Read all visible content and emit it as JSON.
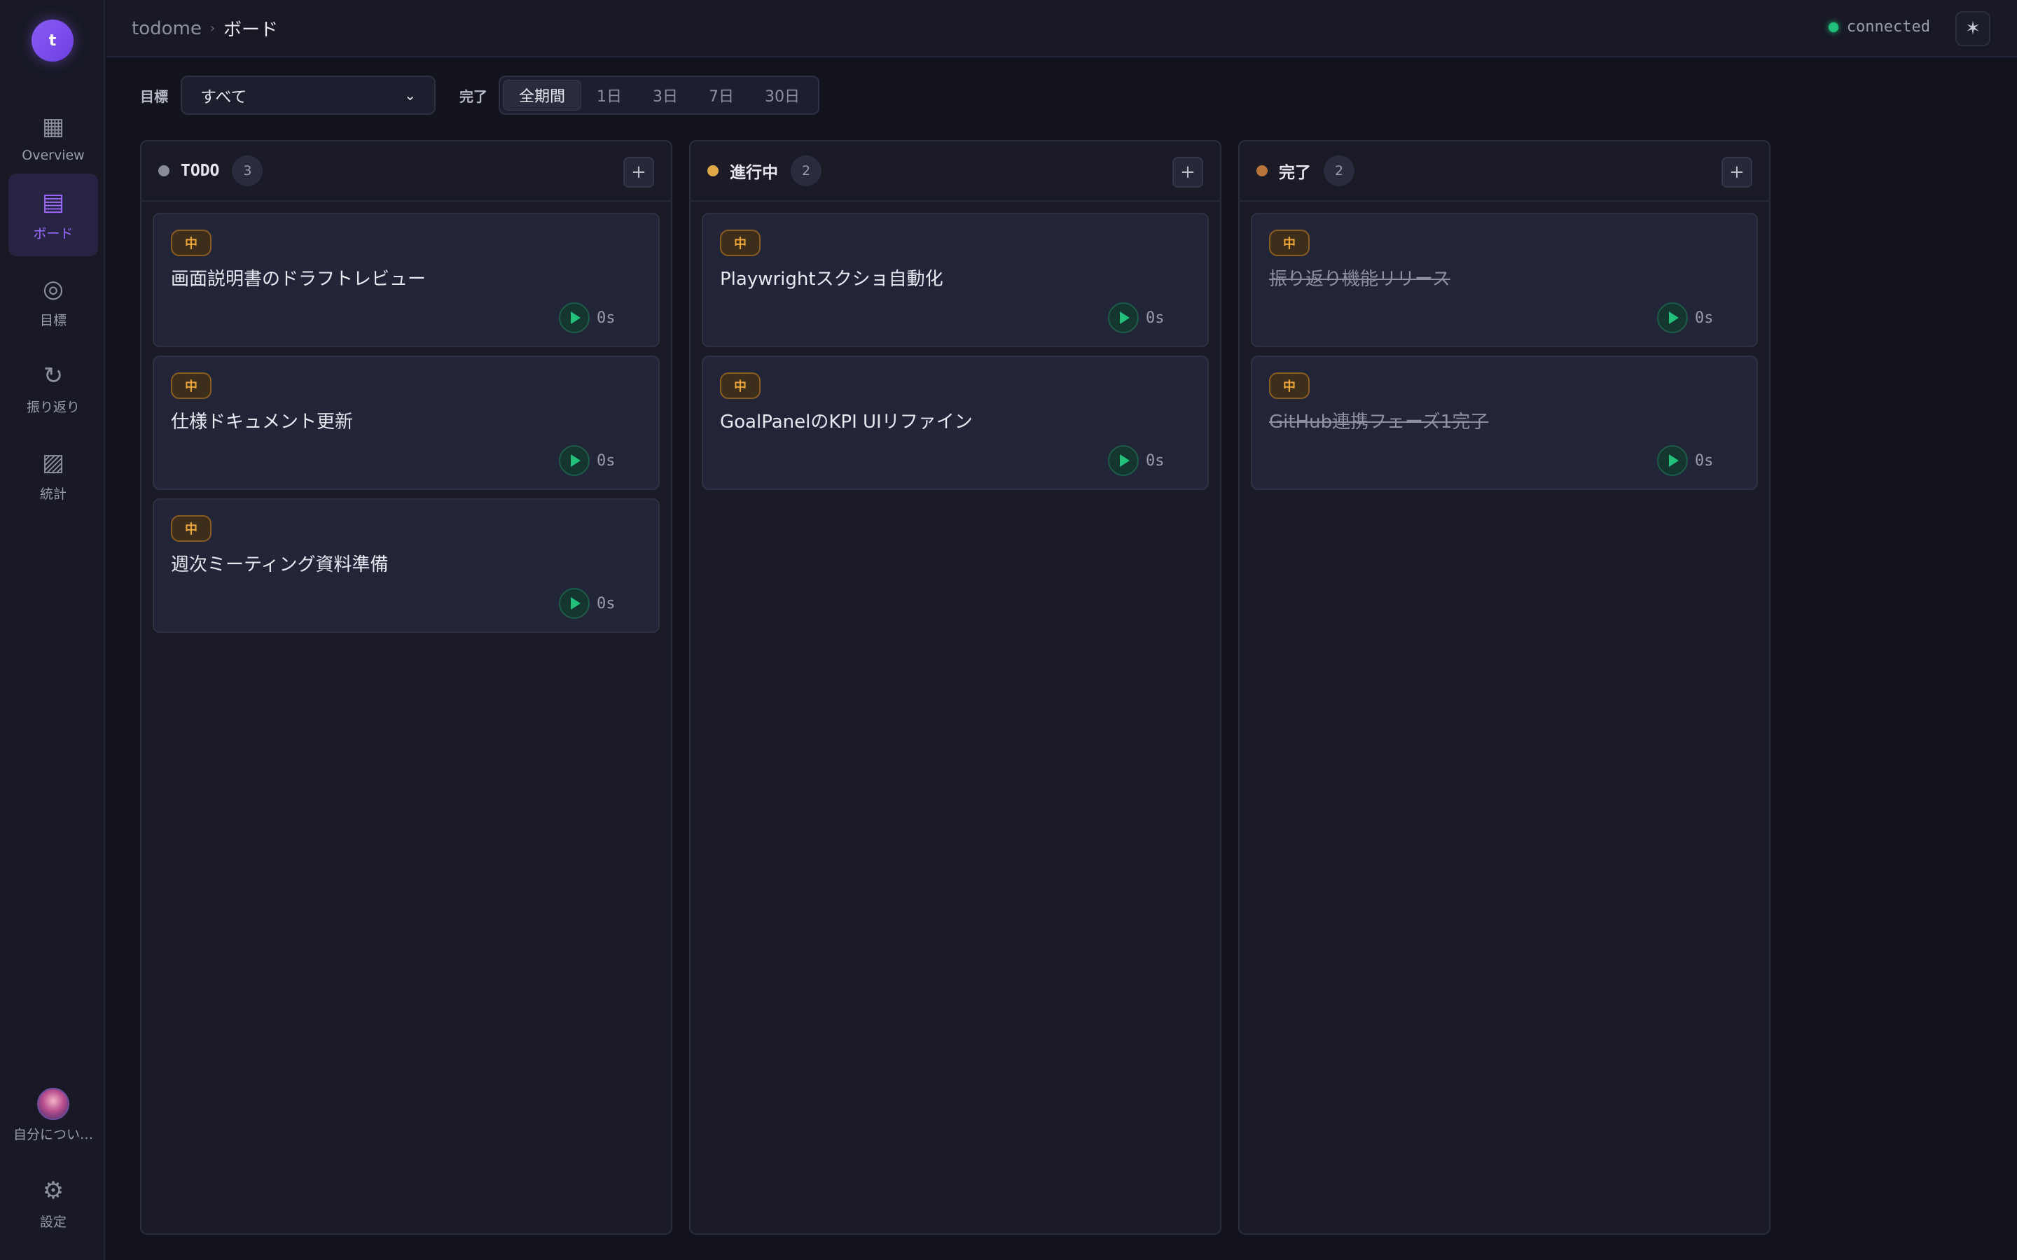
{
  "app": {
    "logo_letter": "t",
    "name": "todome"
  },
  "sidebar": {
    "items": [
      {
        "label": "Overview",
        "icon": "▦"
      },
      {
        "label": "ボード",
        "icon": "▤"
      },
      {
        "label": "目標",
        "icon": "◎"
      },
      {
        "label": "振り返り",
        "icon": "↻"
      },
      {
        "label": "統計",
        "icon": "▨"
      }
    ],
    "profile_label": "自分につい…",
    "settings_label": "設定",
    "settings_icon": "⚙"
  },
  "header": {
    "crumb_root": "todome",
    "crumb_sep": "›",
    "crumb_current": "ボード",
    "status": "connected",
    "theme_icon": "✶"
  },
  "filters": {
    "goal_label": "目標",
    "goal_value": "すべて",
    "done_label": "完了",
    "periods": [
      "全期間",
      "1日",
      "3日",
      "7日",
      "30日"
    ],
    "active_period": "全期間"
  },
  "columns": [
    {
      "title": "TODO",
      "count": "3",
      "color": "#8a8b98",
      "cards": [
        {
          "priority": "中",
          "title": "画面説明書のドラフトレビュー",
          "elapsed": "0s"
        },
        {
          "priority": "中",
          "title": "仕様ドキュメント更新",
          "elapsed": "0s"
        },
        {
          "priority": "中",
          "title": "週次ミーティング資料準備",
          "elapsed": "0s"
        }
      ]
    },
    {
      "title": "進行中",
      "count": "2",
      "color": "#e0a846",
      "cards": [
        {
          "priority": "中",
          "title": "Playwrightスクショ自動化",
          "elapsed": "0s"
        },
        {
          "priority": "中",
          "title": "GoalPanelのKPI UIリファイン",
          "elapsed": "0s"
        }
      ]
    },
    {
      "title": "完了",
      "count": "2",
      "color": "#b8743a",
      "cards": [
        {
          "priority": "中",
          "title": "振り返り機能リリース",
          "elapsed": "0s"
        },
        {
          "priority": "中",
          "title": "GitHub連携フェーズ1完了",
          "elapsed": "0s"
        }
      ]
    }
  ],
  "add_icon": "+"
}
